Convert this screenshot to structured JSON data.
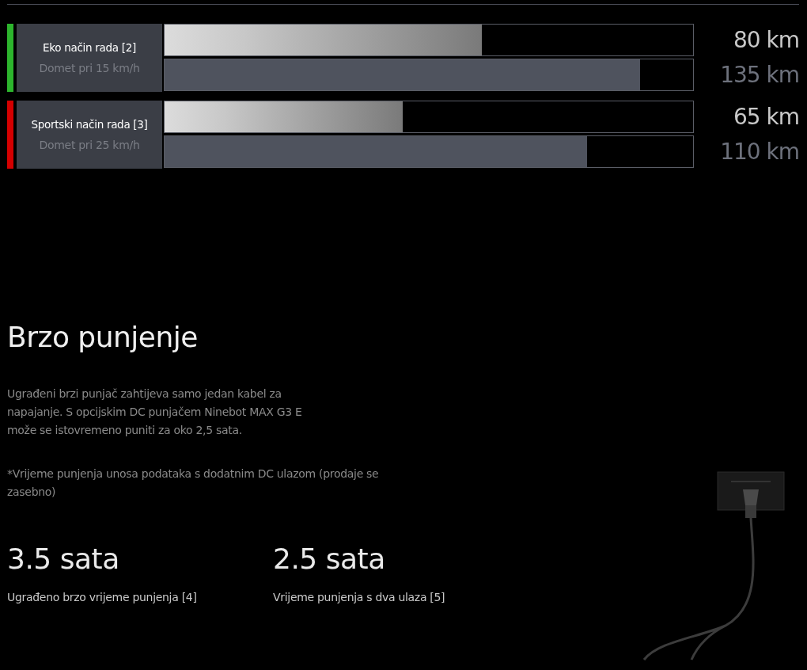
{
  "modes": [
    {
      "name": "Eko način rada [2]",
      "subtitle": "Domet pri 15 km/h",
      "color": "#2db52d",
      "bars": [
        {
          "kind": "measured",
          "level": 0.6,
          "reading": "80 km"
        },
        {
          "kind": "rated",
          "level": 0.9,
          "reading": "135 km"
        }
      ]
    },
    {
      "name": "Sportski način rada [3]",
      "subtitle": "Domet pri 25 km/h",
      "color": "#d40000",
      "bars": [
        {
          "kind": "measured",
          "level": 0.45,
          "reading": "65 km"
        },
        {
          "kind": "rated",
          "level": 0.8,
          "reading": "110 km"
        }
      ]
    }
  ],
  "charging": {
    "title": "Brzo punjenje",
    "description": "Ugrađeni brzi punjač zahtijeva samo jedan kabel za napajanje. S opcijskim DC punjačem Ninebot MAX G3 E može se istovremeno puniti za oko 2,5 sata.",
    "note": "*Vrijeme punjenja unosa podataka s dodatnim DC ulazom (prodaje se zasebno)",
    "stats": [
      {
        "value": "3.5 sata",
        "label": "Ugrađeno brzo vrijeme punjenja [4]"
      },
      {
        "value": "2.5 sata",
        "label": "Vrijeme punjenja s dva ulaza [5]"
      }
    ]
  }
}
